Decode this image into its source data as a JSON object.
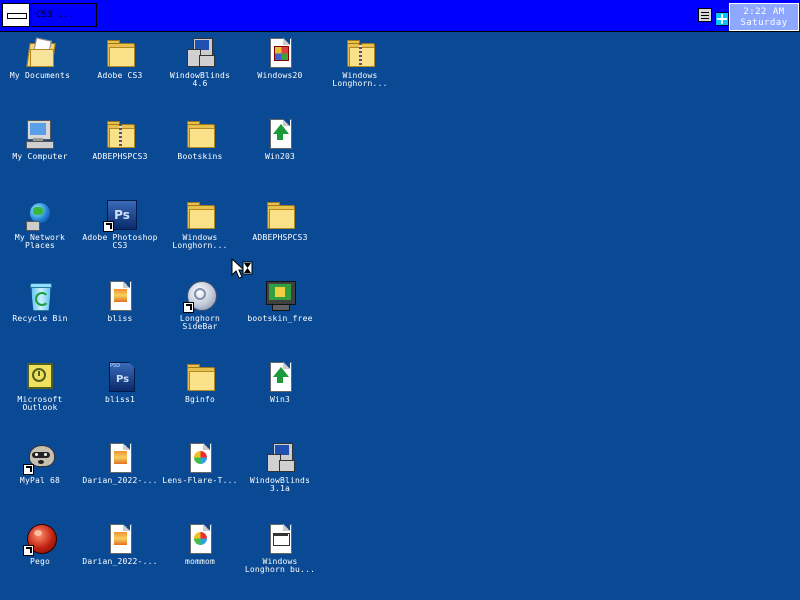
{
  "taskbar": {
    "title_text": "CS3 ...",
    "clock_time": "2:22 AM",
    "clock_day": "Saturday"
  },
  "desktop_icons": [
    {
      "label": "My Documents",
      "icon": "my-documents-icon"
    },
    {
      "label": "Adobe CS3",
      "icon": "folder-icon"
    },
    {
      "label": "WindowBlinds\n4.6",
      "icon": "windowblinds-installer-icon"
    },
    {
      "label": "Windows20",
      "icon": "image-file-icon"
    },
    {
      "label": "Windows\nLonghorn...",
      "icon": "zip-folder-icon"
    },
    {
      "label": "My Computer",
      "icon": "my-computer-icon"
    },
    {
      "label": "ADBEPHSPCS3",
      "icon": "zip-folder-icon"
    },
    {
      "label": "Bootskins",
      "icon": "folder-icon"
    },
    {
      "label": "Win203",
      "icon": "green-arrow-file-icon"
    },
    {
      "label": "My Network\nPlaces",
      "icon": "network-places-icon"
    },
    {
      "label": "Adobe Photoshop\nCS3",
      "icon": "photoshop-shortcut-icon"
    },
    {
      "label": "Windows\nLonghorn...",
      "icon": "folder-icon"
    },
    {
      "label": "ADBEPHSPCS3",
      "icon": "folder-icon"
    },
    {
      "label": "Recycle Bin",
      "icon": "recycle-bin-icon"
    },
    {
      "label": "bliss",
      "icon": "image-file-icon"
    },
    {
      "label": "Longhorn\nSideBar",
      "icon": "sidebar-shortcut-icon"
    },
    {
      "label": "bootskin_free",
      "icon": "monitor-app-icon"
    },
    {
      "label": "Microsoft\nOutlook",
      "icon": "outlook-icon"
    },
    {
      "label": "bliss1",
      "icon": "psd-file-icon"
    },
    {
      "label": "Bginfo",
      "icon": "folder-icon"
    },
    {
      "label": "Win3",
      "icon": "green-arrow-file-icon"
    },
    {
      "label": "MyPal 68",
      "icon": "raccoon-shortcut-icon"
    },
    {
      "label": "Darian_2022-...",
      "icon": "image-file-icon"
    },
    {
      "label": "Lens-Flare-T...",
      "icon": "png-file-icon"
    },
    {
      "label": "WindowBlinds\n3.1a",
      "icon": "windowblinds-installer-icon"
    },
    {
      "label": "Pego",
      "icon": "pego-shortcut-icon"
    },
    {
      "label": "Darian_2022-...",
      "icon": "image-file-icon"
    },
    {
      "label": "mommom",
      "icon": "png-file-icon"
    },
    {
      "label": "Windows\nLonghorn bu...",
      "icon": "app-window-file-icon"
    }
  ],
  "colors": {
    "desktop": "#0a4a94",
    "taskbar": "#0000ff",
    "clock_bg": "#8fa8ff"
  }
}
